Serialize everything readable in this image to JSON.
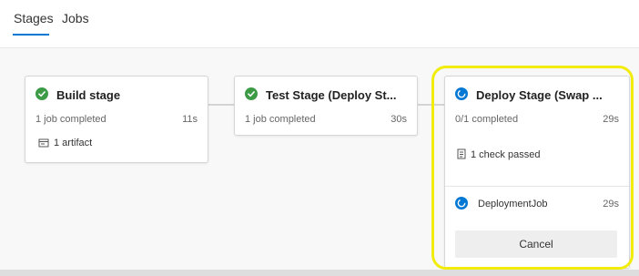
{
  "tabs": {
    "stages": "Stages",
    "jobs": "Jobs"
  },
  "stages": [
    {
      "title": "Build stage",
      "status": "succeeded",
      "summary": "1 job completed",
      "duration": "11s",
      "artifact": "1 artifact"
    },
    {
      "title": "Test Stage (Deploy St...",
      "status": "succeeded",
      "summary": "1 job completed",
      "duration": "30s"
    },
    {
      "title": "Deploy Stage (Swap ...",
      "status": "running",
      "summary": "0/1 completed",
      "duration": "29s",
      "check": "1 check passed",
      "job": {
        "name": "DeploymentJob",
        "duration": "29s"
      },
      "cancel_label": "Cancel"
    }
  ],
  "colors": {
    "success": "#3d9b46",
    "running": "#0078d4",
    "accent": "#0078d4",
    "highlight": "#f1ec0a"
  },
  "icons": {
    "success": "check-circle-icon",
    "running": "in-progress-icon",
    "artifact": "artifact-icon",
    "check": "checklist-icon"
  }
}
